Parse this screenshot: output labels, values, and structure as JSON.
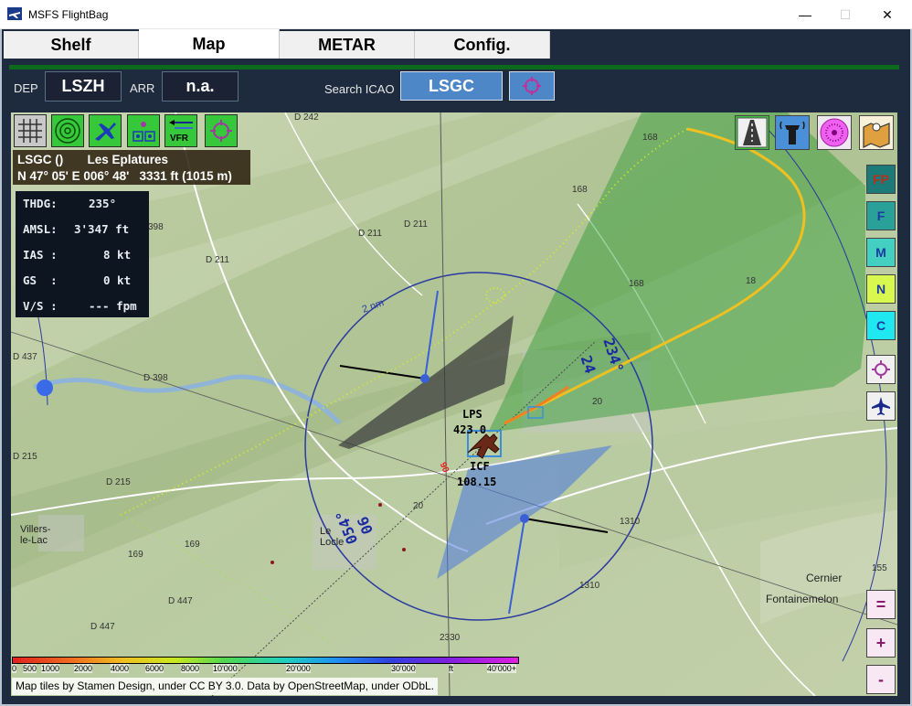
{
  "window": {
    "title": "MSFS FlightBag",
    "icons": {
      "app": "airplane-app-icon",
      "minimize": "minimize-icon",
      "maximize": "maximize-icon",
      "close": "close-icon"
    }
  },
  "tabs": [
    {
      "label": "Shelf"
    },
    {
      "label": "Map",
      "active": true
    },
    {
      "label": "METAR"
    },
    {
      "label": "Config."
    }
  ],
  "header": {
    "dep_label": "DEP",
    "dep_value": "LSZH",
    "arr_label": "ARR",
    "arr_value": "n.a.",
    "search_label": "Search ICAO",
    "search_value": "LSGC"
  },
  "airport_info": {
    "line1": "LSGC ()       Les Eplatures",
    "line2": "N 47° 05' E 006° 48'   3331 ft (1015 m)"
  },
  "telemetry": [
    {
      "label": "THDG:",
      "value": "235°"
    },
    {
      "label": "AMSL:",
      "value": "3'347 ft"
    },
    {
      "label": "IAS :",
      "value": "8 kt"
    },
    {
      "label": "GS  :",
      "value": "0 kt"
    },
    {
      "label": "V/S :",
      "value": "--- fpm"
    }
  ],
  "toolbar_left": [
    {
      "icon": "grid-icon"
    },
    {
      "icon": "range-rings-icon"
    },
    {
      "icon": "aircraft-icon"
    },
    {
      "icon": "navaids-icon"
    },
    {
      "icon": "vfr-icon",
      "label": "VFR"
    },
    {
      "icon": "target-icon"
    }
  ],
  "toolbar_right": [
    {
      "icon": "runway-icon"
    },
    {
      "icon": "tower-icon"
    },
    {
      "icon": "vor-rose-icon"
    },
    {
      "icon": "map-pin-icon"
    }
  ],
  "side_buttons": [
    {
      "label": "FP",
      "color": "#1c7a78",
      "text_color": "#b83018"
    },
    {
      "label": "F",
      "color": "#2aa198",
      "text_color": "#1a3aa0"
    },
    {
      "label": "M",
      "color": "#44d0c0",
      "text_color": "#1a3aa0"
    },
    {
      "label": "N",
      "color": "#d8f850",
      "text_color": "#1a3aa0"
    },
    {
      "label": "C",
      "color": "#20e8f0",
      "text_color": "#1a3aa0"
    }
  ],
  "nav_buttons": [
    {
      "icon": "target-icon"
    },
    {
      "icon": "airplane-icon"
    }
  ],
  "zoom_buttons": [
    {
      "label": "="
    },
    {
      "label": "+"
    },
    {
      "label": "-"
    }
  ],
  "map_labels": {
    "ndb_name": "LPS",
    "ndb_freq": "423.0",
    "vor_name": "ICF",
    "vor_freq": "108.15",
    "rwy_24": "24",
    "rwy_234": "234°",
    "rwy_06": "06",
    "rwy_054": "054°",
    "small_06": "06",
    "range": "2 nm",
    "town1": "Villers-\nle-Lac",
    "town2": "Le\nLocle",
    "town3": "Cernier",
    "town4": "Fontainemelon",
    "roads": [
      "D 242",
      "D 211",
      "D 211",
      "D 211",
      "D 398",
      "D 398",
      "D 437",
      "D 215",
      "D 215",
      "D 447",
      "D 447",
      "168",
      "168",
      "168",
      "20",
      "20",
      "18",
      "1310",
      "1310",
      "2330",
      "169",
      "169",
      "155"
    ]
  },
  "altitude_legend": {
    "ticks": [
      "0",
      "500",
      "1000",
      "2000",
      "4000",
      "6000",
      "8000",
      "10'000",
      "20'000",
      "30'000",
      "ft",
      "40'000+"
    ]
  },
  "attribution": "Map tiles by Stamen Design, under CC BY 3.0. Data by OpenStreetMap, under ODbL."
}
